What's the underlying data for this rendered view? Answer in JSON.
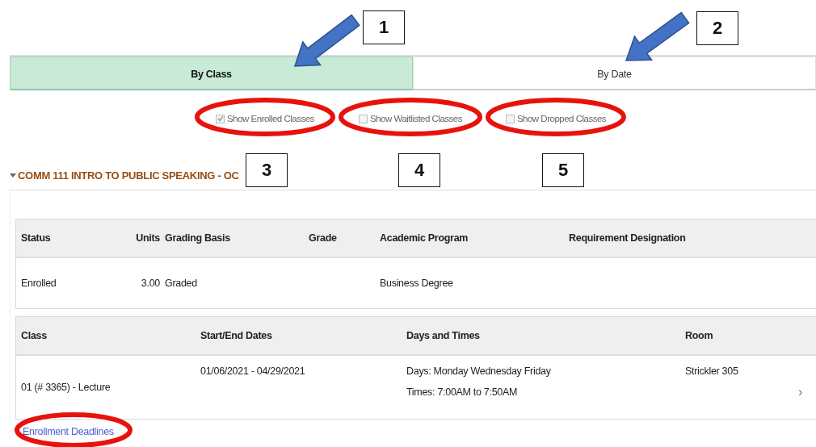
{
  "tabs": [
    {
      "label": "By Class",
      "selected": true
    },
    {
      "label": "By Date",
      "selected": false
    }
  ],
  "filters": [
    {
      "label": "Show Enrolled Classes",
      "checked": true
    },
    {
      "label": "Show Waitlisted Classes",
      "checked": false
    },
    {
      "label": "Show Dropped Classes",
      "checked": false
    }
  ],
  "course": {
    "title": "COMM 111 INTRO TO PUBLIC SPEAKING - OC",
    "expanded": true,
    "enrollment_table": {
      "columns": [
        "Status",
        "Units",
        "Grading Basis",
        "Grade",
        "Academic Program",
        "Requirement Designation"
      ],
      "rows": [
        {
          "status": "Enrolled",
          "units": "3.00",
          "grading_basis": "Graded",
          "academic_program": "Business Degree"
        }
      ]
    },
    "class_table": {
      "columns": [
        "Class",
        "Start/End Dates",
        "Days and Times",
        "Room"
      ],
      "rows": [
        {
          "class": "01 (# 3365) - Lecture",
          "dates": "01/06/2021 - 04/29/2021",
          "days": "Days: Monday Wednesday Friday",
          "times": "Times: 7:00AM to 7:50AM",
          "room": "Strickler 305",
          "chevron": "›"
        }
      ]
    },
    "link": "Enrollment Deadlines"
  },
  "annotations": [
    {
      "label": "1"
    },
    {
      "label": "2"
    },
    {
      "label": "3"
    },
    {
      "label": "4"
    },
    {
      "label": "5"
    }
  ]
}
